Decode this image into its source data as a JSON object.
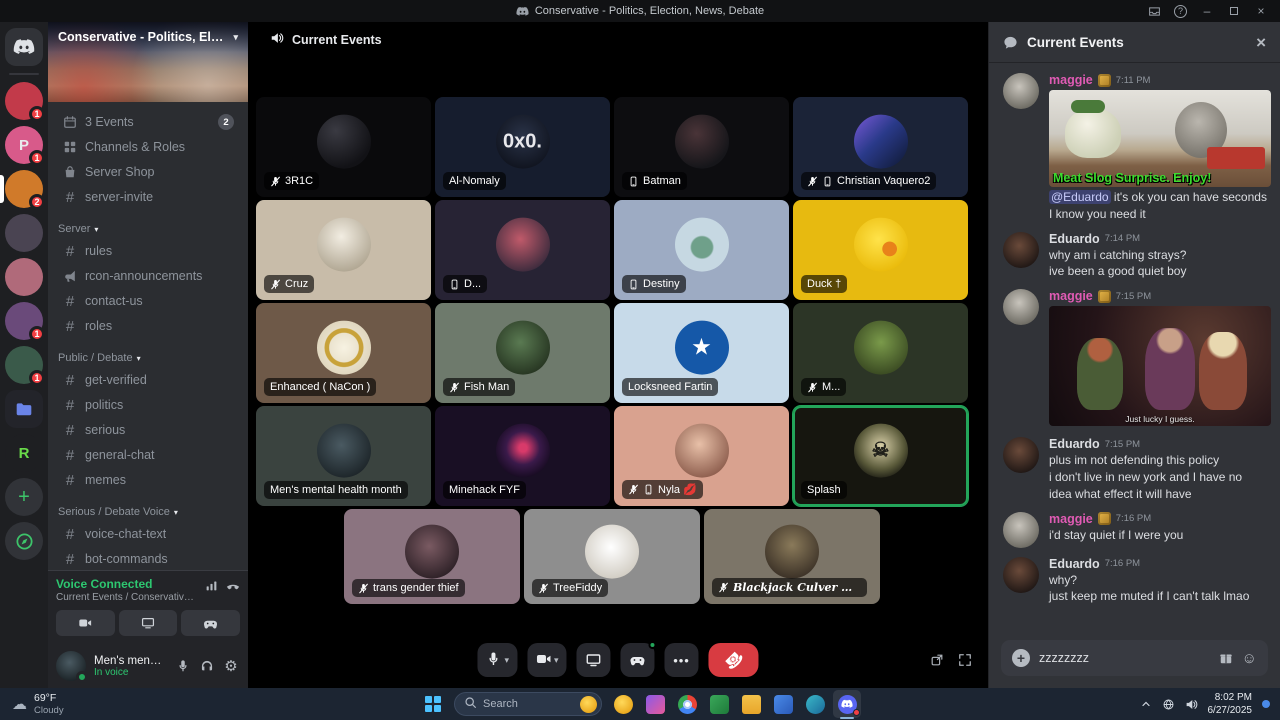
{
  "titlebar": {
    "title": "Conservative - Politics, Election, News, Debate"
  },
  "rail": {
    "servers": [
      {
        "name": "discord-home",
        "bg": "#313338",
        "glyph": "discord"
      },
      {
        "name": "server-1",
        "bg": "#c23a4a",
        "badge": "1"
      },
      {
        "name": "server-2",
        "bg": "#d85a8a",
        "glyph": "P",
        "badge": "1"
      },
      {
        "name": "server-conservative",
        "bg": "#d07a2a",
        "badge": "2",
        "active": true
      },
      {
        "name": "server-4",
        "bg": "#4a4452"
      },
      {
        "name": "server-5",
        "bg": "#b06a7a"
      },
      {
        "name": "server-6",
        "bg": "#6a4a7a",
        "badge": "1"
      },
      {
        "name": "server-7",
        "bg": "#3a5a4a",
        "badge": "1"
      },
      {
        "name": "server-folder",
        "bg": "#23242a",
        "glyph": "folder"
      },
      {
        "name": "server-r",
        "bg": "#1e1f22",
        "glyph": "R",
        "glyphColor": "#6adb4a"
      },
      {
        "name": "add-server",
        "bg": "#313338",
        "glyph": "plus"
      },
      {
        "name": "explore-servers",
        "bg": "#313338",
        "glyph": "compass"
      }
    ]
  },
  "sidebar": {
    "server_name": "Conservative - Politics, Electi...",
    "channels": [
      {
        "type": "feature",
        "icon": "calendar",
        "label": "3 Events",
        "badge": "2"
      },
      {
        "type": "feature",
        "icon": "grid",
        "label": "Channels & Roles"
      },
      {
        "type": "feature",
        "icon": "shop",
        "label": "Server Shop"
      },
      {
        "type": "channel",
        "icon": "hash",
        "label": "server-invite"
      },
      {
        "type": "category",
        "label": "Server"
      },
      {
        "type": "channel",
        "icon": "hash",
        "label": "rules"
      },
      {
        "type": "channel",
        "icon": "announce",
        "label": "rcon-announcements"
      },
      {
        "type": "channel",
        "icon": "hash",
        "label": "contact-us"
      },
      {
        "type": "channel",
        "icon": "hash",
        "label": "roles"
      },
      {
        "type": "category",
        "label": "Public / Debate"
      },
      {
        "type": "channel",
        "icon": "hash",
        "label": "get-verified"
      },
      {
        "type": "channel",
        "icon": "hash",
        "label": "politics"
      },
      {
        "type": "channel",
        "icon": "hash",
        "label": "serious"
      },
      {
        "type": "channel",
        "icon": "hash",
        "label": "general-chat"
      },
      {
        "type": "channel",
        "icon": "hash",
        "label": "memes"
      },
      {
        "type": "category",
        "label": "Serious / Debate Voice"
      },
      {
        "type": "channel",
        "icon": "hash",
        "label": "voice-chat-text"
      },
      {
        "type": "channel",
        "icon": "hash",
        "label": "bot-commands"
      },
      {
        "type": "voice",
        "icon": "speaker",
        "label": "Current Events",
        "active": true
      }
    ],
    "voice_footer": {
      "status": "Voice Connected",
      "location": "Current Events / Conservative - Politics, E..."
    },
    "user": {
      "name": "Men's mental health month",
      "presence": "In voice"
    }
  },
  "voice_main": {
    "header": "Current Events",
    "rows": [
      4,
      4,
      4,
      4,
      3
    ],
    "accent_speaking": "#23a55a",
    "tiles": [
      {
        "name": "3R1C",
        "muted": true,
        "tile": "#0a0a0c",
        "av": "radial-gradient(circle at 35% 30%, #3a3a42, #121216 72%)"
      },
      {
        "name": "Al-Nomaly",
        "tile": "#161d2e",
        "av": "radial-gradient(circle at 50% 40%, #2a3348, #10141f 78%)",
        "glyph": "0x0.",
        "glyphColor": "#e8e8ec",
        "glyphSize": 12
      },
      {
        "name": "Batman",
        "mobile": true,
        "tile": "#0d0d10",
        "av": "radial-gradient(circle at 40% 35%, #4a3438, #16161a 72%)"
      },
      {
        "name": "Christian Vaquero2",
        "muted": true,
        "mobile": true,
        "tile": "#1b2337",
        "av": "linear-gradient(135deg, #7a5ad8 0%, #2a3a8a 45%, #0e1830 100%)"
      },
      {
        "name": "Cruz",
        "muted": true,
        "tile": "#c8bca9",
        "av": "radial-gradient(circle at 45% 35%, #f2ede2, #b0a692 78%)"
      },
      {
        "name": "D...",
        "mobile": true,
        "tile": "#272334",
        "av": "radial-gradient(circle at 45% 40%, #c05a6a, #3a2a3c 78%)"
      },
      {
        "name": "Destiny",
        "mobile": true,
        "tile": "#9dabc3",
        "av": "radial-gradient(circle at 50% 55%, #6fa08a 0 26%, #c6d8e2 30%)"
      },
      {
        "name": "Duck †",
        "tile": "#e7ba10",
        "av": "radial-gradient(circle at 66% 58%, #e8821a 0 15%, rgba(0,0,0,0) 16%), radial-gradient(circle at 45% 40%, #ffe34a, #e9b908 80%)"
      },
      {
        "name": "Enhanced ( NaCon )",
        "tile": "#6e5948",
        "av": "radial-gradient(circle, rgba(0,0,0,0) 0 38%, #c8a23a 40% 50%, rgba(0,0,0,0) 52%), radial-gradient(circle, #f7f2e2, #ddd3ba 80%)"
      },
      {
        "name": "Fish Man",
        "muted": true,
        "tile": "#6e7a6c",
        "av": "radial-gradient(circle at 45% 40%, #5a7a52, #24321f 80%)"
      },
      {
        "name": "Locksneed Fartin",
        "tile": "#c7dae9",
        "av": "#1558a8",
        "glyph": "★",
        "glyphColor": "#ffffff",
        "glyphSize": 24
      },
      {
        "name": "M...",
        "muted": true,
        "tile": "#2c3526",
        "av": "radial-gradient(circle at 50% 40%, #7a9a4a, #3a4a22 78%)"
      },
      {
        "name": "Men's mental health month",
        "tile": "#3a433f",
        "av": "radial-gradient(circle at 45% 40%, #4a5a62, #1c2428 78%)"
      },
      {
        "name": "Minehack FYF",
        "tile": "#190f24",
        "av": "radial-gradient(circle at 50% 45%, #d83a6a 0 10%, #3a1a4a 42%, #140a1e 78%)"
      },
      {
        "name": "Nyla 💋",
        "muted": true,
        "mobile": true,
        "tile": "#d9a28f",
        "av": "radial-gradient(circle at 45% 38%, #e8c0a8, #8a5a4a 80%)"
      },
      {
        "name": "Splash",
        "speaking": true,
        "tile": "#16160f",
        "av": "radial-gradient(circle at 50% 42%, #d8cfa8, #5a5a3a 55%, #1a1a12 82%)",
        "glyph": "☠",
        "glyphColor": "#20201a",
        "glyphSize": 24
      },
      {
        "name": "trans gender thief",
        "muted": true,
        "tile": "#8b7480",
        "av": "radial-gradient(circle at 45% 40%, #7a5a62, #2a1e24 80%)"
      },
      {
        "name": "TreeFiddy",
        "muted": true,
        "tile": "#8e8e8e",
        "av": "radial-gradient(circle at 48% 42%, #ffffff, #cfcac0 80%)"
      },
      {
        "name": "Blackjack Culver Bollaire™",
        "muted": true,
        "gothic": true,
        "tile": "#7c7568",
        "av": "radial-gradient(circle at 50% 38%, #8a7a5a, #3a3026 80%)"
      }
    ]
  },
  "chat": {
    "title": "Current Events",
    "messages": [
      {
        "author": "maggie",
        "color": "#e05bb4",
        "badge": true,
        "time": "7:11 PM",
        "avatar": "radial-gradient(circle at 45% 38%, #c8c4bc, #6a6860 78%)",
        "image": {
          "cls": "img-restaurant",
          "caption": "Meat Slog Surprise. Enjoy!",
          "caption_color": "#3ddd2e"
        },
        "parts": [
          {
            "mention": "@Eduardo"
          },
          {
            "text": " it's ok you can have seconds I know you need it"
          }
        ]
      },
      {
        "author": "Eduardo",
        "color": "#dcdee2",
        "time": "7:14 PM",
        "avatar": "radial-gradient(circle at 45% 38%, #6a4a3a, #1e1614 78%)",
        "lines": [
          "why am i catching strays?",
          "ive been a good quiet boy"
        ]
      },
      {
        "author": "maggie",
        "color": "#e05bb4",
        "badge": true,
        "time": "7:15 PM",
        "avatar": "radial-gradient(circle at 45% 38%, #c8c4bc, #6a6860 78%)",
        "image": {
          "cls": "img-witches",
          "caption": "Just lucky I guess.",
          "caption_color": "#e8e8e8",
          "small": true
        }
      },
      {
        "author": "Eduardo",
        "color": "#dcdee2",
        "time": "7:15 PM",
        "avatar": "radial-gradient(circle at 45% 38%, #6a4a3a, #1e1614 78%)",
        "lines": [
          "plus im not defending this policy",
          "i don't live in new york and I have no idea what effect it will have"
        ]
      },
      {
        "author": "maggie",
        "color": "#e05bb4",
        "badge": true,
        "time": "7:16 PM",
        "avatar": "radial-gradient(circle at 45% 38%, #c8c4bc, #6a6860 78%)",
        "lines": [
          "i'd stay quiet if I were you"
        ]
      },
      {
        "author": "Eduardo",
        "color": "#dcdee2",
        "time": "7:16 PM",
        "avatar": "radial-gradient(circle at 45% 38%, #6a4a3a, #1e1614 78%)",
        "lines": [
          "why?",
          "just keep me muted if I can't talk lmao"
        ]
      }
    ],
    "input": {
      "value": "zzzzzzzz"
    }
  },
  "taskbar": {
    "weather_temp": "69°F",
    "weather_cond": "Cloudy",
    "search": "Search",
    "clock_time": "8:02 PM",
    "clock_date": "6/27/2025",
    "apps": [
      {
        "name": "duck-app",
        "cls": "app-duck"
      },
      {
        "name": "photos-app",
        "cls": "app-photo"
      },
      {
        "name": "chrome-app",
        "cls": "app-chrome"
      },
      {
        "name": "green-app",
        "cls": "app-green"
      },
      {
        "name": "file-explorer-app",
        "cls": "app-folder"
      },
      {
        "name": "blue-app",
        "cls": "app-blue"
      },
      {
        "name": "teal-app",
        "cls": "app-teal"
      },
      {
        "name": "discord-app",
        "cls": "app-discord",
        "active": true,
        "badge": true
      }
    ]
  }
}
